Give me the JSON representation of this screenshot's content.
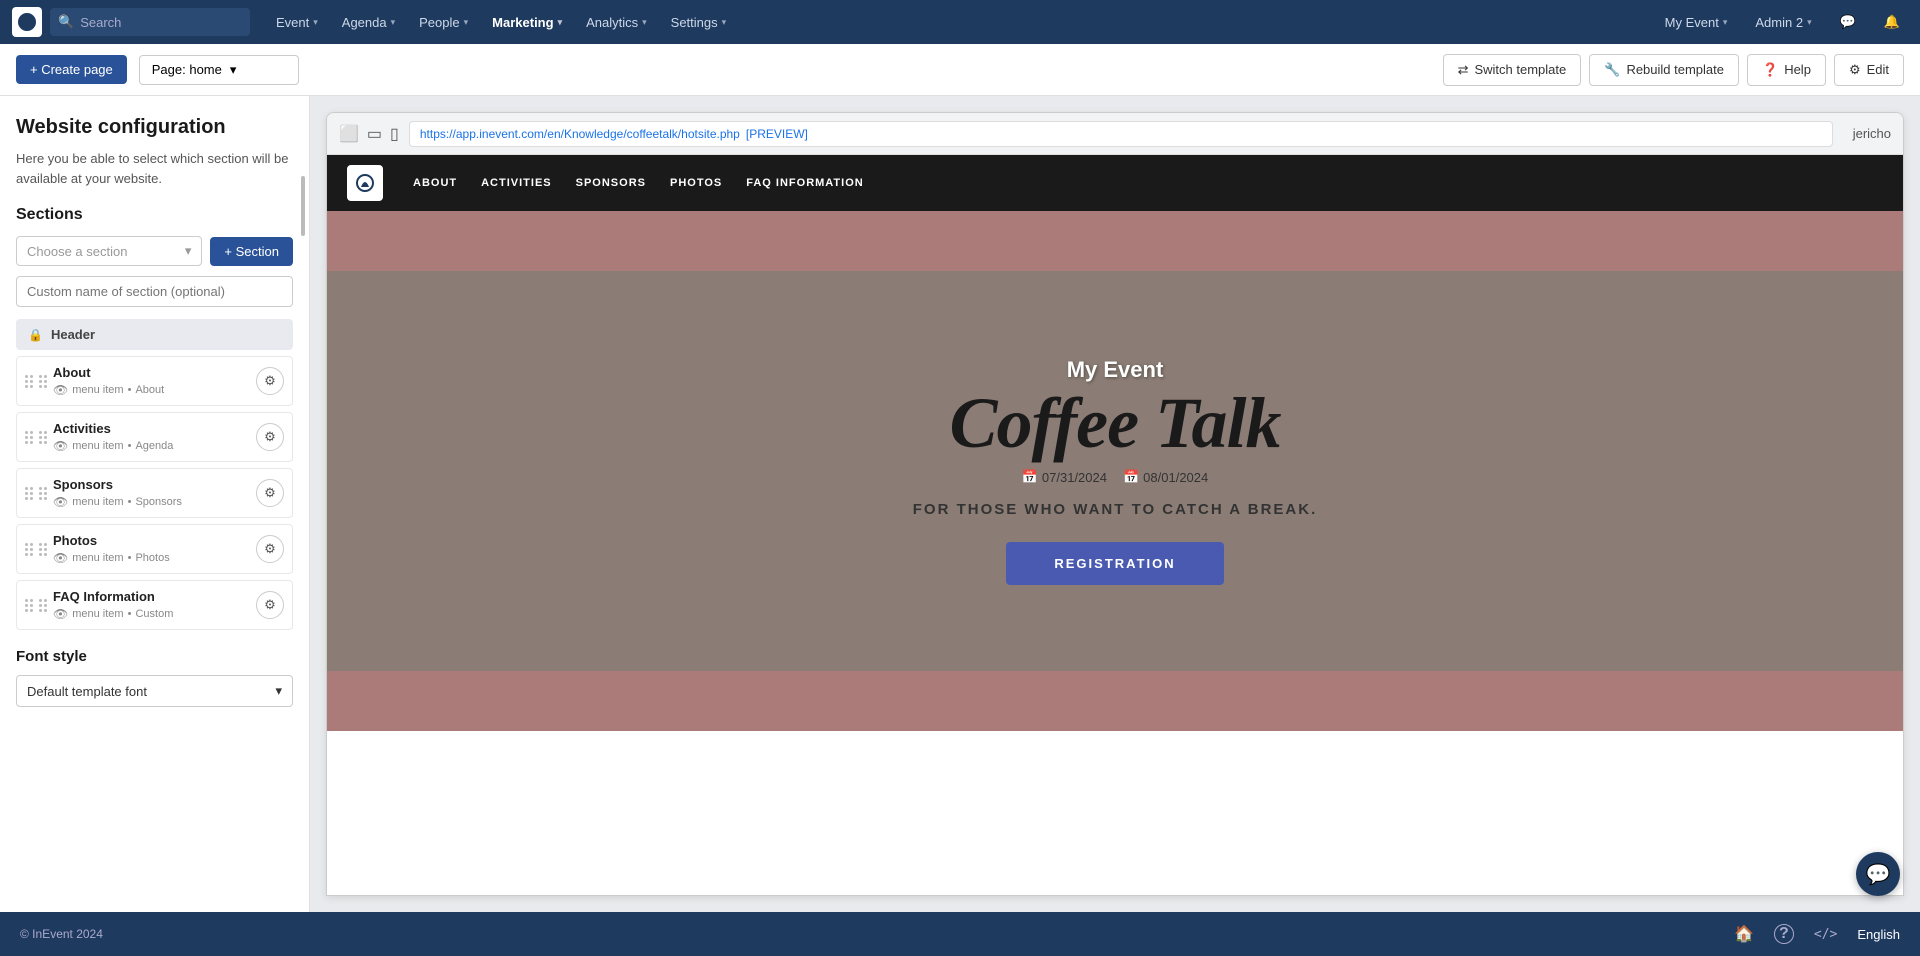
{
  "app": {
    "logo_alt": "InEvent logo"
  },
  "topnav": {
    "search_placeholder": "Search",
    "items": [
      {
        "label": "Event",
        "has_dropdown": true,
        "active": false
      },
      {
        "label": "Agenda",
        "has_dropdown": true,
        "active": false
      },
      {
        "label": "People",
        "has_dropdown": true,
        "active": false
      },
      {
        "label": "Marketing",
        "has_dropdown": true,
        "active": true
      },
      {
        "label": "Analytics",
        "has_dropdown": true,
        "active": false
      },
      {
        "label": "Settings",
        "has_dropdown": true,
        "active": false
      }
    ],
    "right": {
      "event_name": "My Event",
      "admin_name": "Admin 2",
      "chat_icon": "💬",
      "bell_icon": "🔔"
    }
  },
  "toolbar": {
    "create_page_label": "+ Create page",
    "page_selector_label": "Page: home",
    "switch_template_label": "Switch template",
    "rebuild_template_label": "Rebuild template",
    "help_label": "Help",
    "edit_label": "Edit"
  },
  "left_panel": {
    "title": "Website configuration",
    "description": "Here you be able to select which section will be available at your website.",
    "sections_title": "Sections",
    "choose_section_placeholder": "Choose a section",
    "add_section_label": "+ Section",
    "custom_name_placeholder": "Custom name of section (optional)",
    "header_group_label": "Header",
    "sections": [
      {
        "name": "About",
        "meta_type": "menu item",
        "meta_value": "About"
      },
      {
        "name": "Activities",
        "meta_type": "menu item",
        "meta_value": "Agenda"
      },
      {
        "name": "Sponsors",
        "meta_type": "menu item",
        "meta_value": "Sponsors"
      },
      {
        "name": "Photos",
        "meta_type": "menu item",
        "meta_value": "Photos"
      },
      {
        "name": "FAQ Information",
        "meta_type": "menu item",
        "meta_value": "Custom"
      }
    ],
    "font_style_title": "Font style",
    "font_default_label": "Default template font"
  },
  "preview": {
    "url": "https://app.inevent.com/en/Knowledge/coffeetalk/hotsite.php",
    "preview_label": "[PREVIEW]",
    "browser_name": "jericho",
    "site_logo_alt": "Site logo",
    "nav_items": [
      "ABOUT",
      "ACTIVITIES",
      "SPONSORS",
      "PHOTOS",
      "FAQ INFORMATION"
    ],
    "hero": {
      "event_name": "My Event",
      "title": "Coffee Talk",
      "date_start": "07/31/2024",
      "date_end": "08/01/2024",
      "tagline": "FOR THOSE WHO WANT TO CATCH A BREAK.",
      "register_label": "REGISTRATION"
    }
  },
  "bottom_bar": {
    "copyright": "© InEvent 2024",
    "language": "English",
    "home_icon": "🏠",
    "help_icon": "?",
    "code_icon": "<>"
  }
}
